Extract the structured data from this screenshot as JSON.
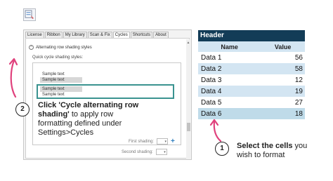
{
  "dialog": {
    "tabs": [
      {
        "label": "License"
      },
      {
        "label": "Ribbon"
      },
      {
        "label": "My Library"
      },
      {
        "label": "Scan & Fix"
      },
      {
        "label": "Cycles",
        "active": true
      },
      {
        "label": "Shortcuts"
      },
      {
        "label": "About"
      }
    ],
    "section_label": "Alternating row shading styles",
    "quick_label": "Quick cycle shading styles:",
    "styles": [
      {
        "line1": "Sample text",
        "line2": "Sample text"
      },
      {
        "line1": "Sample text",
        "line2": "Sample text",
        "selected": true
      }
    ],
    "first_shading_label": "First shading:",
    "second_shading_label": "Second shading:"
  },
  "table": {
    "header": "Header",
    "columns": [
      "Name",
      "Value"
    ],
    "rows": [
      {
        "name": "Data 1",
        "value": "56"
      },
      {
        "name": "Data 2",
        "value": "58"
      },
      {
        "name": "Data 3",
        "value": "12"
      },
      {
        "name": "Data 4",
        "value": "19"
      },
      {
        "name": "Data 5",
        "value": "27"
      },
      {
        "name": "Data 6",
        "value": "18"
      }
    ]
  },
  "callouts": {
    "step2": {
      "number": "2",
      "bold": "Click 'Cycle alternating row shading'",
      "rest": " to apply row formatting defined under Settings>Cycles"
    },
    "step1": {
      "number": "1",
      "bold": "Select the cells",
      "rest": " you wish to format"
    }
  },
  "colors": {
    "arrow_pink": "#e0427d",
    "selection_teal": "#3a9390",
    "header_navy": "#133c57",
    "row_shade": "#d3e5f2"
  },
  "icons": [
    "app-icon",
    "chevron-up-icon",
    "scroll-up-arrow-icon",
    "dropdown-caret-icon",
    "plus-icon",
    "curved-arrow-icon"
  ]
}
